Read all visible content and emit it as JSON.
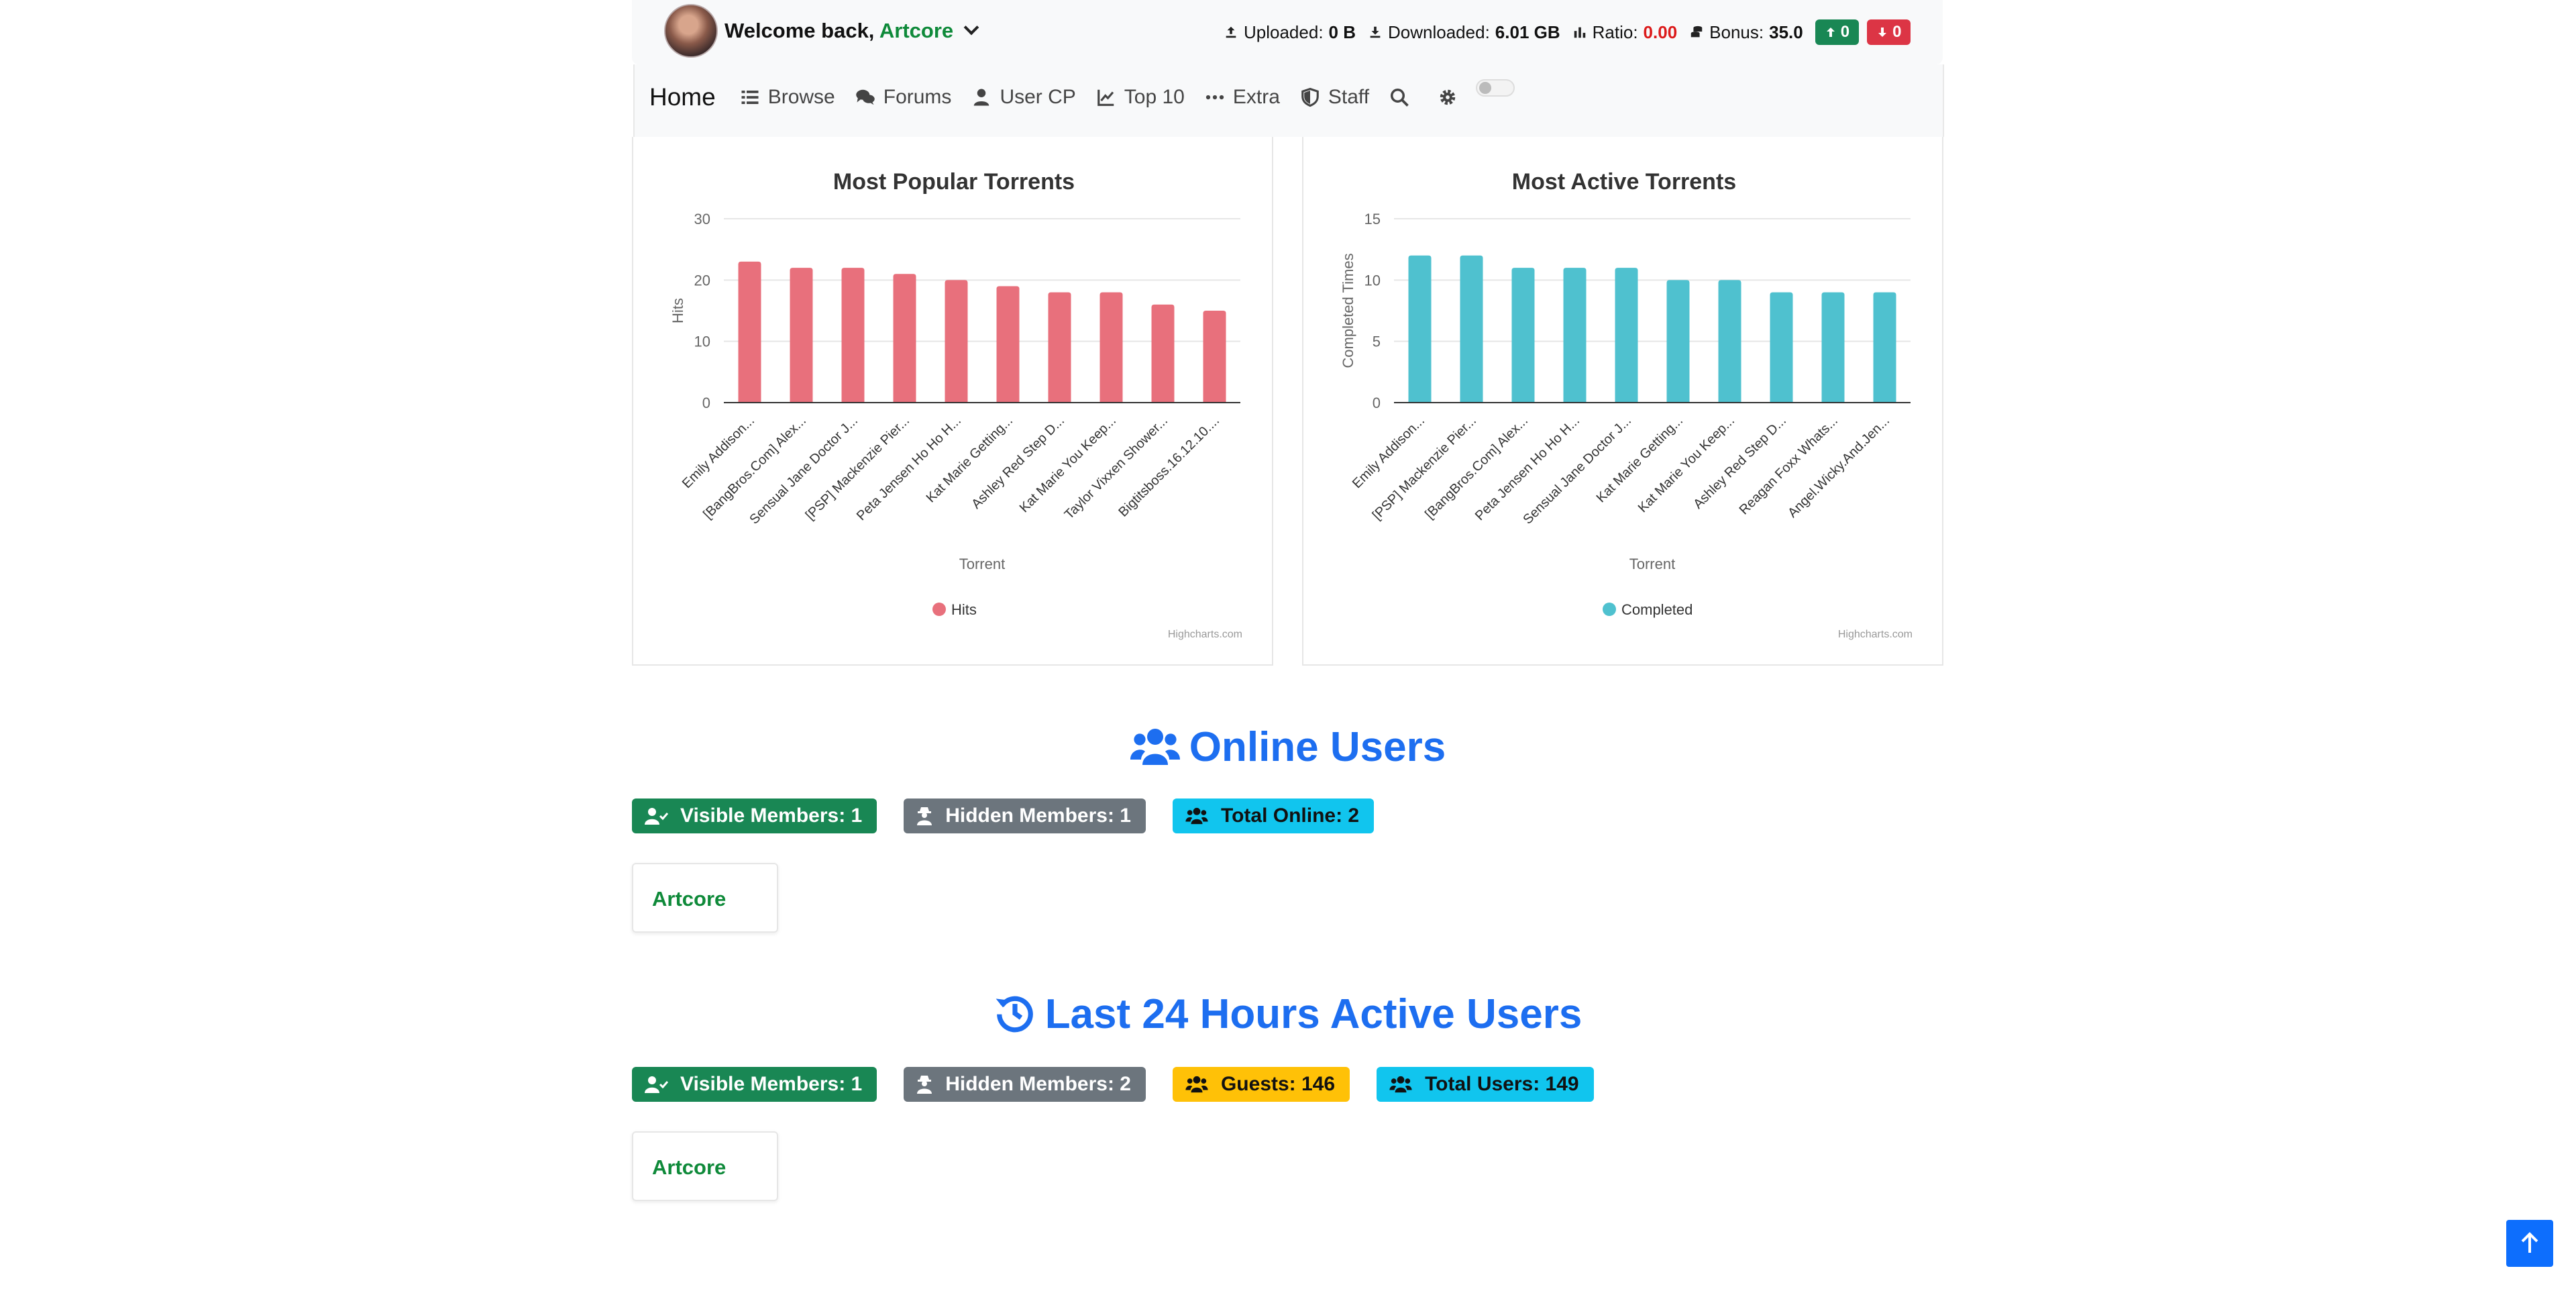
{
  "header": {
    "welcome_prefix": "Welcome back,",
    "username": "Artcore",
    "stats": {
      "uploaded_label": "Uploaded:",
      "uploaded_value": "0 B",
      "downloaded_label": "Downloaded:",
      "downloaded_value": "6.01 GB",
      "ratio_label": "Ratio:",
      "ratio_value": "0.00",
      "bonus_label": "Bonus:",
      "bonus_value": "35.0",
      "seeding_count": "0",
      "leeching_count": "0"
    }
  },
  "nav": {
    "home": "Home",
    "browse": "Browse",
    "forums": "Forums",
    "usercp": "User CP",
    "top10": "Top 10",
    "extra": "Extra",
    "staff": "Staff"
  },
  "chart_data": [
    {
      "type": "bar",
      "title": "Most Popular Torrents",
      "xlabel": "Torrent",
      "ylabel": "Hits",
      "ylim": [
        0,
        30
      ],
      "yticks": [
        0,
        10,
        20,
        30
      ],
      "categories": [
        "Emily Addison...",
        "[BangBros.Com] Alex...",
        "Sensual Jane Doctor J...",
        "[PSP] Mackenzie Pier...",
        "Peta Jensen Ho Ho H...",
        "Kat Marie Getting...",
        "Ashley Red Step D...",
        "Kat Marie You Keep...",
        "Taylor Vixxen Shower...",
        "Bigtitsboss.16.12.10...."
      ],
      "series": [
        {
          "name": "Hits",
          "values": [
            23,
            22,
            22,
            21,
            20,
            19,
            18,
            18,
            16,
            15
          ]
        }
      ],
      "color": "#e8707c",
      "credits": "Highcharts.com",
      "grid": true,
      "legend": "bottom-center"
    },
    {
      "type": "bar",
      "title": "Most Active Torrents",
      "xlabel": "Torrent",
      "ylabel": "Completed Times",
      "ylim": [
        0,
        15
      ],
      "yticks": [
        0,
        5,
        10,
        15
      ],
      "categories": [
        "Emily Addison...",
        "[PSP] Mackenzie Pier...",
        "[BangBros.Com] Alex...",
        "Peta Jensen Ho Ho H...",
        "Sensual Jane Doctor J...",
        "Kat Marie Getting...",
        "Kat Marie You Keep...",
        "Ashley Red Step D...",
        "Reagan Foxx Whats...",
        "Angel.Wicky.And.Jen..."
      ],
      "series": [
        {
          "name": "Completed",
          "values": [
            12,
            12,
            11,
            11,
            11,
            10,
            10,
            9,
            9,
            9
          ]
        }
      ],
      "color": "#4fc1cf",
      "credits": "Highcharts.com",
      "grid": true,
      "legend": "bottom-center"
    }
  ],
  "online": {
    "title": "Online Users",
    "visible": "Visible Members: 1",
    "hidden": "Hidden Members: 1",
    "total": "Total Online: 2",
    "user": "Artcore"
  },
  "last24": {
    "title": "Last 24 Hours Active Users",
    "visible": "Visible Members: 1",
    "hidden": "Hidden Members: 2",
    "guests": "Guests: 146",
    "total": "Total Users: 149",
    "user": "Artcore"
  }
}
